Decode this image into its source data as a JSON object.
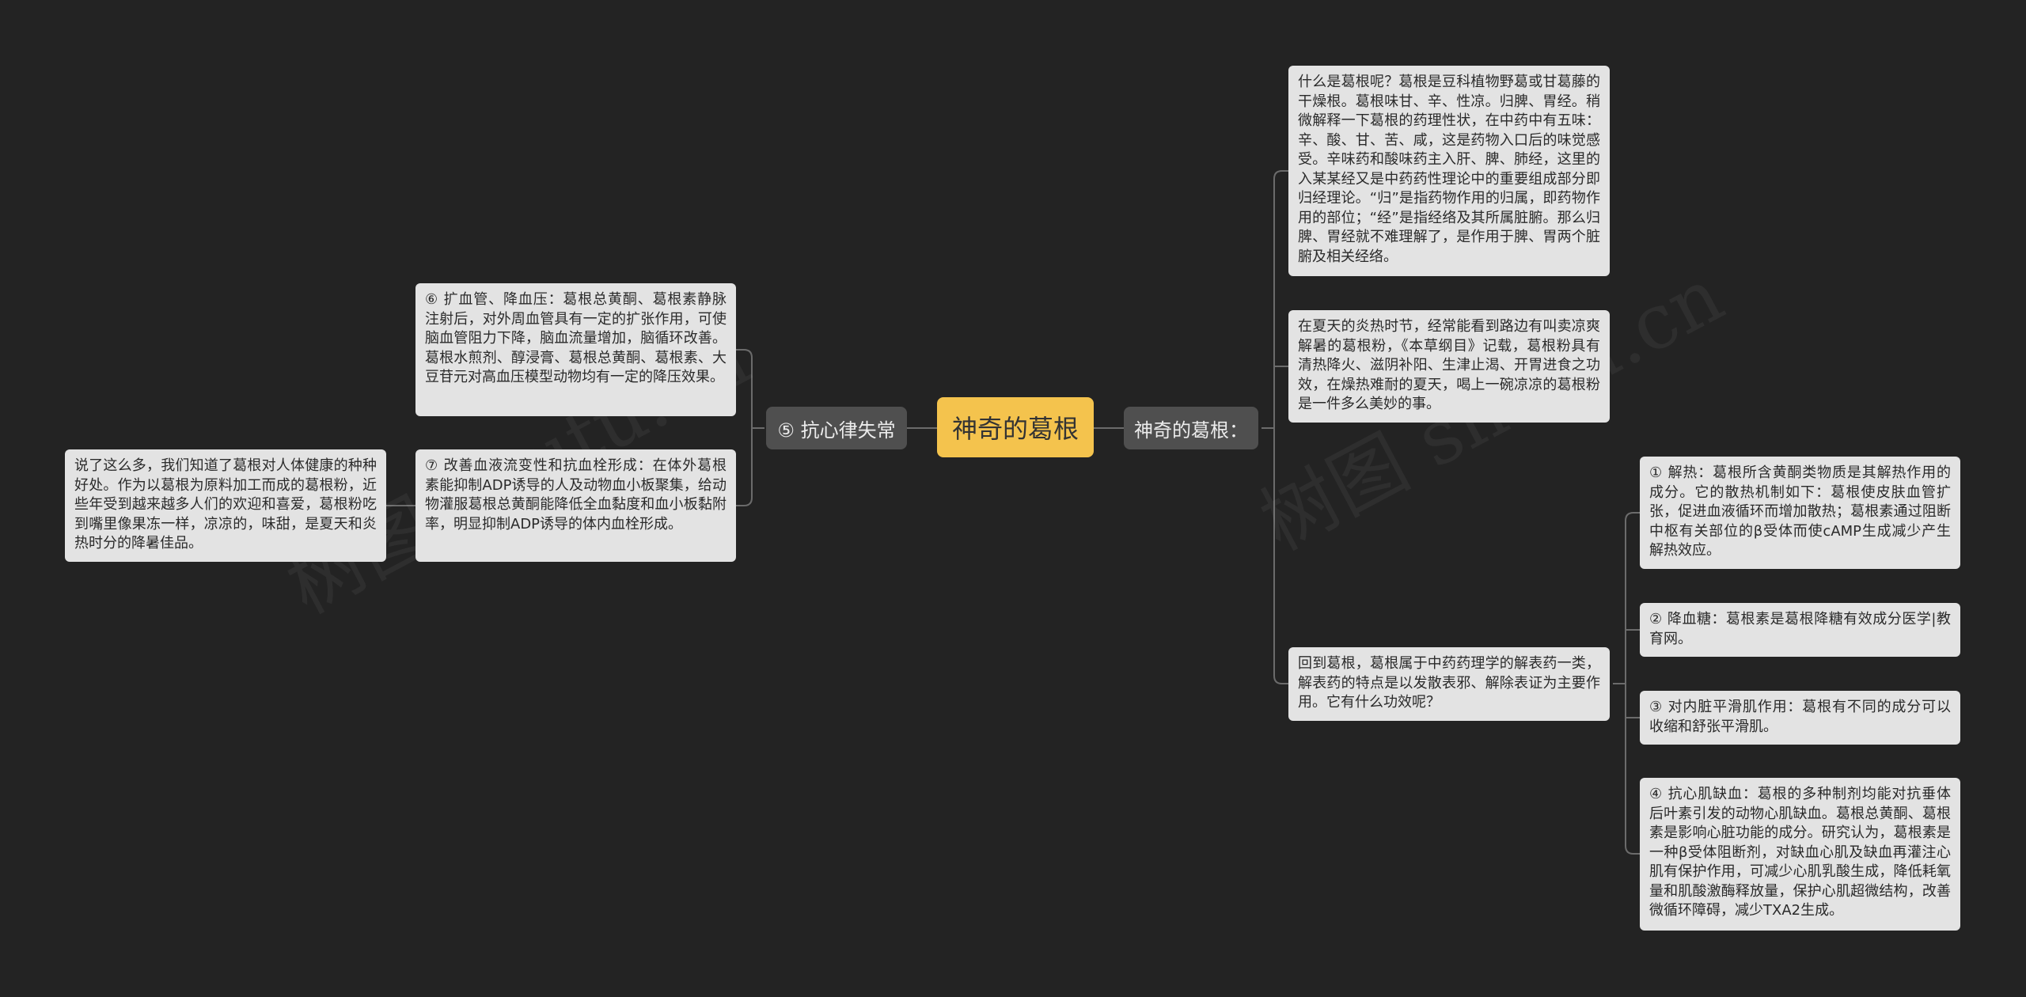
{
  "colors": {
    "background": "#232323",
    "center": "#f4c34d",
    "branch": "#4f4f4f",
    "leaf": "#e3e3e3",
    "connector": "#6b6b6b"
  },
  "center": {
    "label": "神奇的葛根"
  },
  "left_branch": {
    "label": "⑤ 抗心律失常",
    "items": [
      {
        "text": "⑥ 扩血管、降血压：葛根总黄酮、葛根素静脉注射后，对外周血管具有一定的扩张作用，可使脑血管阻力下降，脑血流量增加，脑循环改善。葛根水煎剂、醇浸膏、葛根总黄酮、葛根素、大豆苷元对高血压模型动物均有一定的降压效果。"
      },
      {
        "text": "⑦ 改善血液流变性和抗血栓形成：在体外葛根素能抑制ADP诱导的人及动物血小板聚集，给动物灌服葛根总黄酮能降低全血黏度和血小板黏附率，明显抑制ADP诱导的体内血栓形成。"
      }
    ],
    "conclusion": "说了这么多，我们知道了葛根对人体健康的种种好处。作为以葛根为原料加工而成的葛根粉，近些年受到越来越多人们的欢迎和喜爱，葛根粉吃到嘴里像果冻一样，凉凉的，味甜，是夏天和炎热时分的降暑佳品。"
  },
  "right_branch": {
    "label": "神奇的葛根：",
    "items": [
      {
        "text": "什么是葛根呢？葛根是豆科植物野葛或甘葛藤的干燥根。葛根味甘、辛、性凉。归脾、胃经。稍微解释一下葛根的药理性状，在中药中有五味：辛、酸、甘、苦、咸，这是药物入口后的味觉感受。辛味药和酸味药主入肝、脾、肺经，这里的入某某经又是中药药性理论中的重要组成部分即归经理论。“归”是指药物作用的归属，即药物作用的部位；“经”是指经络及其所属脏腑。那么归脾、胃经就不难理解了，是作用于脾、胃两个脏腑及相关经络。"
      },
      {
        "text": "在夏天的炎热时节，经常能看到路边有叫卖凉爽解暑的葛根粉，《本草纲目》记载，葛根粉具有清热降火、滋阴补阳、生津止渴、开胃进食之功效，在燥热难耐的夏天，喝上一碗凉凉的葛根粉是一件多么美妙的事。"
      },
      {
        "text": "回到葛根，葛根属于中药药理学的解表药一类，解表药的特点是以发散表邪、解除表证为主要作用。它有什么功效呢？"
      }
    ],
    "effects": [
      {
        "text": "① 解热：葛根所含黄酮类物质是其解热作用的成分。它的散热机制如下：葛根使皮肤血管扩张，促进血液循环而增加散热；葛根素通过阻断中枢有关部位的β受体而使cAMP生成减少产生解热效应。"
      },
      {
        "text": "② 降血糖：葛根素是葛根降糖有效成分医学|教育网。"
      },
      {
        "text": "③ 对内脏平滑肌作用：葛根有不同的成分可以收缩和舒张平滑肌。"
      },
      {
        "text": "④ 抗心肌缺血：葛根的多种制剂均能对抗垂体后叶素引发的动物心肌缺血。葛根总黄酮、葛根素是影响心脏功能的成分。研究认为，葛根素是一种β受体阻断剂，对缺血心肌及缺血再灌注心肌有保护作用，可减少心肌乳酸生成，降低耗氧量和肌酸激酶释放量，保护心肌超微结构，改善微循环障碍，减少TXA2生成。"
      }
    ]
  },
  "watermarks": [
    "树图 shutu.cn",
    "树图 shutu.cn"
  ]
}
